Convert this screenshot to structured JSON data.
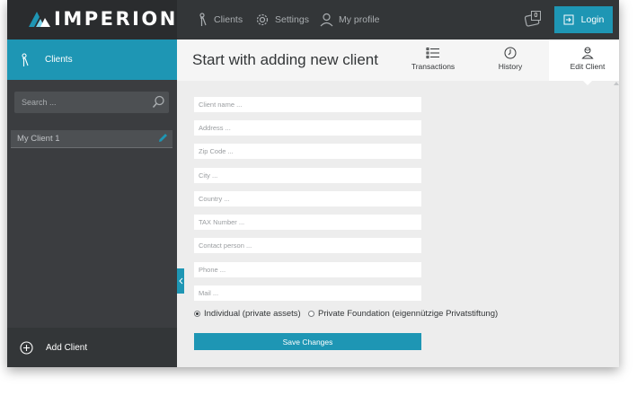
{
  "header": {
    "logo_text": "IMPERION",
    "nav": [
      {
        "label": "Clients",
        "icon": "user-icon"
      },
      {
        "label": "Settings",
        "icon": "gear-icon"
      },
      {
        "label": "My profile",
        "icon": "person-icon"
      }
    ],
    "wallet_count": "0",
    "login_label": "Login"
  },
  "sidebar": {
    "title": "Clients",
    "search_placeholder": "Search ...",
    "clients": [
      "My Client 1"
    ],
    "add_client_label": "Add Client"
  },
  "main": {
    "title": "Start with adding new client",
    "tabs": [
      {
        "label": "Transactions",
        "icon": "list-icon"
      },
      {
        "label": "History",
        "icon": "clock-icon"
      },
      {
        "label": "Edit Client",
        "icon": "person-edit-icon"
      }
    ],
    "fields": [
      "Client name ...",
      "Address ...",
      "Zip Code ...",
      "City ...",
      "Country ...",
      "TAX Number ...",
      "Contact person ...",
      "Phone ...",
      "Mail ..."
    ],
    "radio_options": [
      {
        "label": "Individual (private assets)",
        "selected": true
      },
      {
        "label": "Private Foundation (eigennützige Privatstiftung)",
        "selected": false
      }
    ],
    "save_label": "Save Changes"
  },
  "colors": {
    "accent": "#1e96b4",
    "topbar": "#333638",
    "sidebar": "#3b3d40",
    "content_bg": "#ededed"
  }
}
